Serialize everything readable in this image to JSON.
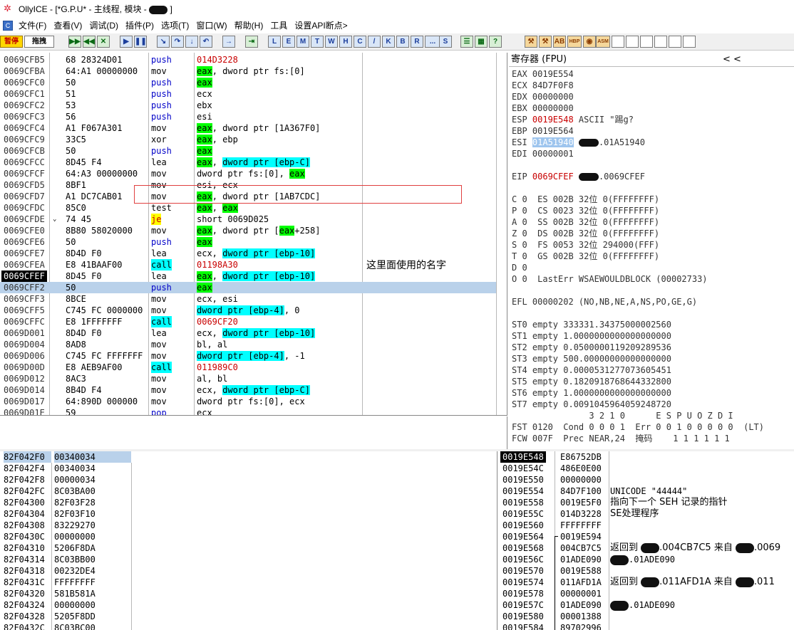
{
  "window": {
    "title_prefix": "OllyICE - [*G.P.U* - 主线程, 模块 -",
    "title_suffix": "]"
  },
  "menu": [
    "文件(F)",
    "查看(V)",
    "调试(D)",
    "插件(P)",
    "选项(T)",
    "窗口(W)",
    "帮助(H)",
    "工具",
    "设置API断点>"
  ],
  "toolbar": {
    "pause": "暂停",
    "drag": "拖拽",
    "letters": [
      "L",
      "E",
      "M",
      "T",
      "W",
      "H",
      "C",
      "/",
      "K",
      "B",
      "R",
      "...",
      "S"
    ],
    "plugins": [
      "HBP",
      "ASM"
    ]
  },
  "disasm": {
    "rows": [
      {
        "addr": "0069CFB5",
        "hex": "68 28324D01",
        "op": "push",
        "args": "014D3228"
      },
      {
        "addr": "0069CFBA",
        "hex": "64:A1 00000000",
        "op": "mov",
        "args": "eax, dword ptr fs:[0]"
      },
      {
        "addr": "0069CFC0",
        "hex": "50",
        "op": "push",
        "args": "eax"
      },
      {
        "addr": "0069CFC1",
        "hex": "51",
        "op": "push",
        "args": "ecx"
      },
      {
        "addr": "0069CFC2",
        "hex": "53",
        "op": "push",
        "args": "ebx"
      },
      {
        "addr": "0069CFC3",
        "hex": "56",
        "op": "push",
        "args": "esi"
      },
      {
        "addr": "0069CFC4",
        "hex": "A1 F067A301",
        "op": "mov",
        "args": "eax, dword ptr [1A367F0]"
      },
      {
        "addr": "0069CFC9",
        "hex": "33C5",
        "op": "xor",
        "args": "eax, ebp"
      },
      {
        "addr": "0069CFCB",
        "hex": "50",
        "op": "push",
        "args": "eax"
      },
      {
        "addr": "0069CFCC",
        "hex": "8D45 F4",
        "op": "lea",
        "args": "eax, dword ptr [ebp-C]"
      },
      {
        "addr": "0069CFCF",
        "hex": "64:A3 00000000",
        "op": "mov",
        "args": "dword ptr fs:[0], eax"
      },
      {
        "addr": "0069CFD5",
        "hex": "8BF1",
        "op": "mov",
        "args": "esi, ecx"
      },
      {
        "addr": "0069CFD7",
        "hex": "A1 DC7CAB01",
        "op": "mov",
        "args": "eax, dword ptr [1AB7CDC]"
      },
      {
        "addr": "0069CFDC",
        "hex": "85C0",
        "op": "test",
        "args": "eax, eax"
      },
      {
        "addr": "0069CFDE",
        "hex": "74 45",
        "op": "je",
        "args": "short 0069D025"
      },
      {
        "addr": "0069CFE0",
        "hex": "8B80 58020000",
        "op": "mov",
        "args": "eax, dword ptr [eax+258]"
      },
      {
        "addr": "0069CFE6",
        "hex": "50",
        "op": "push",
        "args": "eax"
      },
      {
        "addr": "0069CFE7",
        "hex": "8D4D F0",
        "op": "lea",
        "args": "ecx, dword ptr [ebp-10]"
      },
      {
        "addr": "0069CFEA",
        "hex": "E8 41BAAF00",
        "op": "call",
        "args": "01198A30"
      },
      {
        "addr": "0069CFEF",
        "hex": "8D45 F0",
        "op": "lea",
        "args": "eax, dword ptr [ebp-10]"
      },
      {
        "addr": "0069CFF2",
        "hex": "50",
        "op": "push",
        "args": "eax"
      },
      {
        "addr": "0069CFF3",
        "hex": "8BCE",
        "op": "mov",
        "args": "ecx, esi"
      },
      {
        "addr": "0069CFF5",
        "hex": "C745 FC 0000000",
        "op": "mov",
        "args": "dword ptr [ebp-4], 0"
      },
      {
        "addr": "0069CFFC",
        "hex": "E8 1FFFFFFF",
        "op": "call",
        "args": "0069CF20"
      },
      {
        "addr": "0069D001",
        "hex": "8D4D F0",
        "op": "lea",
        "args": "ecx, dword ptr [ebp-10]"
      },
      {
        "addr": "0069D004",
        "hex": "8AD8",
        "op": "mov",
        "args": "bl, al"
      },
      {
        "addr": "0069D006",
        "hex": "C745 FC FFFFFFF",
        "op": "mov",
        "args": "dword ptr [ebp-4], -1"
      },
      {
        "addr": "0069D00D",
        "hex": "E8 AEB9AF00",
        "op": "call",
        "args": "011989C0"
      },
      {
        "addr": "0069D012",
        "hex": "8AC3",
        "op": "mov",
        "args": "al, bl"
      },
      {
        "addr": "0069D014",
        "hex": "8B4D F4",
        "op": "mov",
        "args": "ecx, dword ptr [ebp-C]"
      },
      {
        "addr": "0069D017",
        "hex": "64:890D 000000",
        "op": "mov",
        "args": "dword ptr fs:[0], ecx"
      },
      {
        "addr": "0069D01E",
        "hex": "59",
        "op": "pop",
        "args": "ecx"
      }
    ],
    "note": "这里面使用的名字"
  },
  "registers": {
    "header": "寄存器 (FPU)",
    "header_arrows": "<        <",
    "lines": [
      "EAX 0019E554",
      "ECX 84D7F0F8",
      "EDX 00000000",
      "EBX 00000000",
      "ESP 0019E548 ASCII \"踢g?",
      "EBP 0019E564",
      "ESI 01A51940 ●.01A51940",
      "EDI 00000001",
      "",
      "EIP 0069CFEF ●.0069CFEF",
      "",
      "C 0  ES 002B 32位 0(FFFFFFFF)",
      "P 0  CS 0023 32位 0(FFFFFFFF)",
      "A 0  SS 002B 32位 0(FFFFFFFF)",
      "Z 0  DS 002B 32位 0(FFFFFFFF)",
      "S 0  FS 0053 32位 294000(FFF)",
      "T 0  GS 002B 32位 0(FFFFFFFF)",
      "D 0",
      "O 0  LastErr WSAEWOULDBLOCK (00002733)",
      "",
      "EFL 00000202 (NO,NB,NE,A,NS,PO,GE,G)",
      "",
      "ST0 empty 333331.34375000002560",
      "ST1 empty 1.0000000000000000000",
      "ST2 empty 0.0500000119209289536",
      "ST3 empty 500.00000000000000000",
      "ST4 empty 0.0000531277073605451",
      "ST5 empty 0.1820918768644332800",
      "ST6 empty 1.0000000000000000000",
      "ST7 empty 0.0091045964059248720",
      "               3 2 1 0      E S P U O Z D I",
      "FST 0120  Cond 0 0 0 1  Err 0 0 1 0 0 0 0 0  (LT)",
      "FCW 007F  Prec NEAR,24  掩码    1 1 1 1 1 1"
    ]
  },
  "dump": {
    "rows": [
      {
        "addr": "82F042F0",
        "val": "00340034"
      },
      {
        "addr": "82F042F4",
        "val": "00340034"
      },
      {
        "addr": "82F042F8",
        "val": "00000034"
      },
      {
        "addr": "82F042FC",
        "val": "8C03BA00"
      },
      {
        "addr": "82F04300",
        "val": "82F03F28"
      },
      {
        "addr": "82F04304",
        "val": "82F03F10"
      },
      {
        "addr": "82F04308",
        "val": "83229270"
      },
      {
        "addr": "82F0430C",
        "val": "00000000"
      },
      {
        "addr": "82F04310",
        "val": "5206F8DA"
      },
      {
        "addr": "82F04314",
        "val": "8C03BB00"
      },
      {
        "addr": "82F04318",
        "val": "00232DE4"
      },
      {
        "addr": "82F0431C",
        "val": "FFFFFFFF"
      },
      {
        "addr": "82F04320",
        "val": "581B581A"
      },
      {
        "addr": "82F04324",
        "val": "00000000"
      },
      {
        "addr": "82F04328",
        "val": "5205F8DD"
      },
      {
        "addr": "82F0432C",
        "val": "8C03BC00"
      }
    ]
  },
  "stack": {
    "rows": [
      {
        "addr": "0019E548",
        "val": "E86752DB",
        "cmt": ""
      },
      {
        "addr": "0019E54C",
        "val": "486E0E00",
        "cmt": ""
      },
      {
        "addr": "0019E550",
        "val": "00000000",
        "cmt": ""
      },
      {
        "addr": "0019E554",
        "val": "84D7F100",
        "cmt": "UNICODE \"44444\""
      },
      {
        "addr": "0019E558",
        "val": "0019E5F0",
        "cmt": "指向下一个 SEH 记录的指针"
      },
      {
        "addr": "0019E55C",
        "val": "014D3228",
        "cmt": "SE处理程序"
      },
      {
        "addr": "0019E560",
        "val": "FFFFFFFF",
        "cmt": ""
      },
      {
        "addr": "0019E564",
        "val": "0019E594",
        "cmt": ""
      },
      {
        "addr": "0019E568",
        "val": "004CB7C5",
        "cmt": "返回到 ●.004CB7C5 来自 ●.0069"
      },
      {
        "addr": "0019E56C",
        "val": "01ADE090",
        "cmt": "●.01ADE090"
      },
      {
        "addr": "0019E570",
        "val": "0019E588",
        "cmt": ""
      },
      {
        "addr": "0019E574",
        "val": "011AFD1A",
        "cmt": "返回到 ●.011AFD1A 来自 ●.011"
      },
      {
        "addr": "0019E578",
        "val": "00000001",
        "cmt": ""
      },
      {
        "addr": "0019E57C",
        "val": "01ADE090",
        "cmt": "●.01ADE090"
      },
      {
        "addr": "0019E580",
        "val": "00001388",
        "cmt": ""
      },
      {
        "addr": "0019E584",
        "val": "89702996",
        "cmt": ""
      }
    ]
  }
}
